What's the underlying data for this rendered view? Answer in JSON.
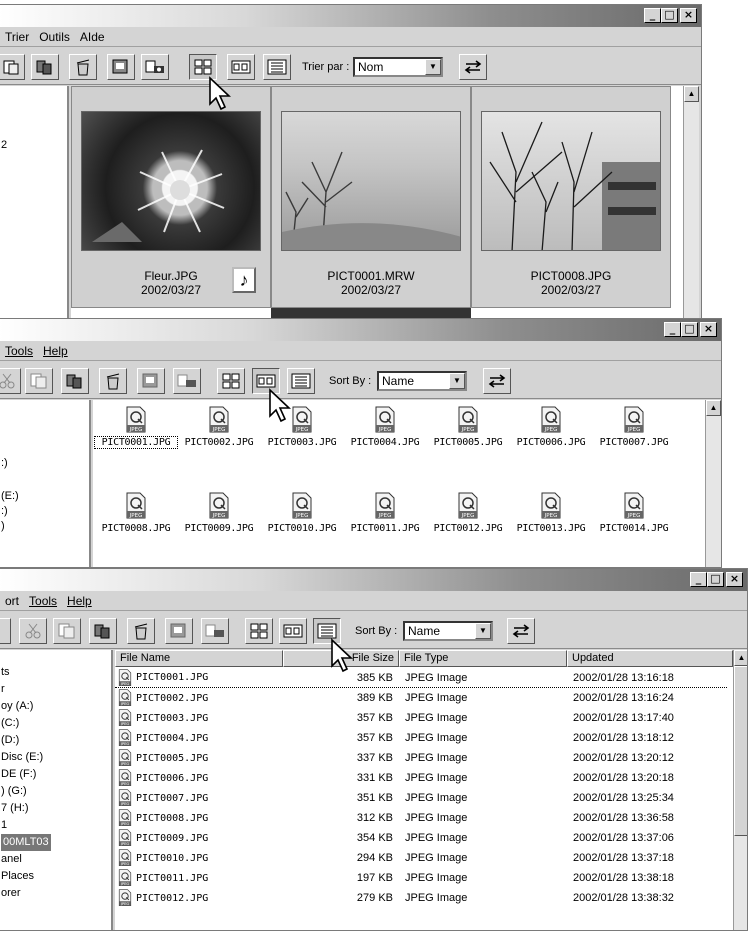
{
  "win1": {
    "menu": [
      "Trier",
      "Outils",
      "AIde"
    ],
    "sort_label": "Trier par :",
    "sort_value": "Nom",
    "tree_items": [
      "2"
    ],
    "thumbs": [
      {
        "name": "Fleur.JPG",
        "date": "2002/03/27",
        "has_audio": true
      },
      {
        "name": "PICT0001.MRW",
        "date": "2002/03/27"
      },
      {
        "name": "PICT0008.JPG",
        "date": "2002/03/27"
      }
    ]
  },
  "win2": {
    "menu": [
      "Tools",
      "Help"
    ],
    "sort_label": "Sort By :",
    "sort_value": "Name",
    "tree_items": [
      ":)",
      "(E:)",
      ":)",
      ")"
    ],
    "icons_row1": [
      "PICT0001.JPG",
      "PICT0002.JPG",
      "PICT0003.JPG",
      "PICT0004.JPG",
      "PICT0005.JPG",
      "PICT0006.JPG",
      "PICT0007.JPG"
    ],
    "icons_row2": [
      "PICT0008.JPG",
      "PICT0009.JPG",
      "PICT0010.JPG",
      "PICT0011.JPG",
      "PICT0012.JPG",
      "PICT0013.JPG",
      "PICT0014.JPG"
    ]
  },
  "win3": {
    "menu": [
      "ort",
      "Tools",
      "Help"
    ],
    "sort_label": "Sort By :",
    "sort_value": "Name",
    "tree_items": [
      "ts",
      "r",
      "oy (A:)",
      "(C:)",
      "(D:)",
      "Disc (E:)",
      "DE (F:)",
      ") (G:)",
      "7 (H:)",
      "1",
      "00MLT03",
      "anel",
      "Places",
      "orer"
    ],
    "columns": [
      "File Name",
      "File Size",
      "File Type",
      "Updated"
    ],
    "rows": [
      {
        "name": "PICT0001.JPG",
        "size": "385 KB",
        "type": "JPEG Image",
        "updated": "2002/01/28 13:16:18"
      },
      {
        "name": "PICT0002.JPG",
        "size": "389 KB",
        "type": "JPEG Image",
        "updated": "2002/01/28 13:16:24"
      },
      {
        "name": "PICT0003.JPG",
        "size": "357 KB",
        "type": "JPEG Image",
        "updated": "2002/01/28 13:17:40"
      },
      {
        "name": "PICT0004.JPG",
        "size": "357 KB",
        "type": "JPEG Image",
        "updated": "2002/01/28 13:18:12"
      },
      {
        "name": "PICT0005.JPG",
        "size": "337 KB",
        "type": "JPEG Image",
        "updated": "2002/01/28 13:20:12"
      },
      {
        "name": "PICT0006.JPG",
        "size": "331 KB",
        "type": "JPEG Image",
        "updated": "2002/01/28 13:20:18"
      },
      {
        "name": "PICT0007.JPG",
        "size": "351 KB",
        "type": "JPEG Image",
        "updated": "2002/01/28 13:25:34"
      },
      {
        "name": "PICT0008.JPG",
        "size": "312 KB",
        "type": "JPEG Image",
        "updated": "2002/01/28 13:36:58"
      },
      {
        "name": "PICT0009.JPG",
        "size": "354 KB",
        "type": "JPEG Image",
        "updated": "2002/01/28 13:37:06"
      },
      {
        "name": "PICT0010.JPG",
        "size": "294 KB",
        "type": "JPEG Image",
        "updated": "2002/01/28 13:37:18"
      },
      {
        "name": "PICT0011.JPG",
        "size": "197 KB",
        "type": "JPEG Image",
        "updated": "2002/01/28 13:38:18"
      },
      {
        "name": "PICT0012.JPG",
        "size": "279 KB",
        "type": "JPEG Image",
        "updated": "2002/01/28 13:38:32"
      }
    ]
  },
  "icons": {
    "jpeg_badge": "JPEG",
    "audio_glyph": "♪"
  },
  "window_controls": {
    "minimize": "_",
    "maximize": "□",
    "close": "×"
  }
}
